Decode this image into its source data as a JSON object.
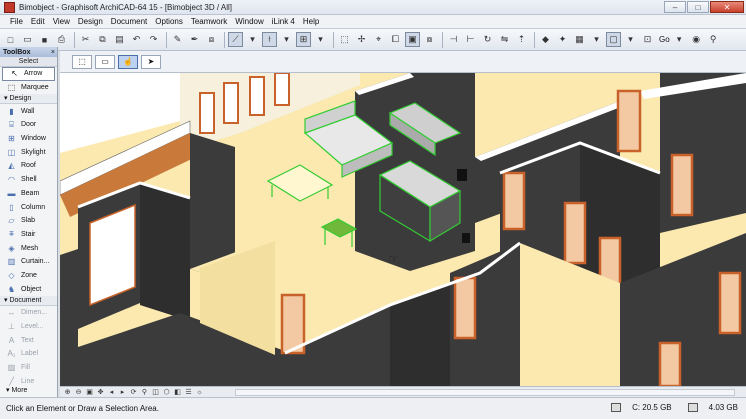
{
  "window": {
    "title": "Bimobject - Graphisoft ArchiCAD-64 15 - [Bimobject 3D / All]",
    "minimize": "–",
    "maximize": "□",
    "close": "✕"
  },
  "menu": [
    "File",
    "Edit",
    "View",
    "Design",
    "Document",
    "Options",
    "Teamwork",
    "Window",
    "iLink 4",
    "Help"
  ],
  "toolbar": {
    "go_label": "Go"
  },
  "toolbox": {
    "title": "ToolBox",
    "close": "×",
    "select_section": "Select",
    "select_tools": [
      {
        "label": "Arrow",
        "icon": "arrow-icon"
      },
      {
        "label": "Marquee",
        "icon": "marquee-icon"
      }
    ],
    "design_group": "Design",
    "design_tools": [
      {
        "label": "Wall",
        "icon": "wall-icon"
      },
      {
        "label": "Door",
        "icon": "door-icon"
      },
      {
        "label": "Window",
        "icon": "window-icon"
      },
      {
        "label": "Skylight",
        "icon": "skylight-icon"
      },
      {
        "label": "Roof",
        "icon": "roof-icon"
      },
      {
        "label": "Shell",
        "icon": "shell-icon"
      },
      {
        "label": "Beam",
        "icon": "beam-icon"
      },
      {
        "label": "Column",
        "icon": "column-icon"
      },
      {
        "label": "Slab",
        "icon": "slab-icon"
      },
      {
        "label": "Stair",
        "icon": "stair-icon"
      },
      {
        "label": "Mesh",
        "icon": "mesh-icon"
      },
      {
        "label": "Curtain...",
        "icon": "curtain-wall-icon"
      },
      {
        "label": "Zone",
        "icon": "zone-icon"
      },
      {
        "label": "Object",
        "icon": "object-icon"
      }
    ],
    "document_group": "Document",
    "document_tools": [
      {
        "label": "Dimen...",
        "icon": "dimension-icon"
      },
      {
        "label": "Level...",
        "icon": "level-dimension-icon"
      },
      {
        "label": "Text",
        "icon": "text-icon"
      },
      {
        "label": "Label",
        "icon": "label-icon"
      },
      {
        "label": "Fill",
        "icon": "fill-icon"
      },
      {
        "label": "Line",
        "icon": "line-icon"
      }
    ],
    "more": "More"
  },
  "status": {
    "message": "Click an Element or Draw a Selection Area.",
    "disk_c": "C: 20.5 GB",
    "memory": "4.03 GB"
  },
  "colors": {
    "floor": "#fbe9b0",
    "wall_face": "#3b3b3b",
    "wall_top": "#ffffff",
    "door_frame": "#c8622a",
    "selection": "#33cc33"
  }
}
